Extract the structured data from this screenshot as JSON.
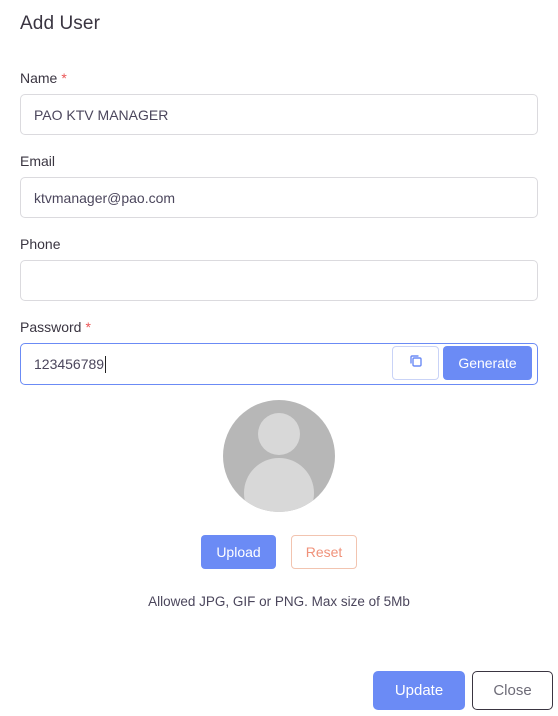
{
  "dialog": {
    "title": "Add User"
  },
  "form": {
    "name": {
      "label": "Name",
      "required_mark": "*",
      "value": "PAO KTV MANAGER"
    },
    "email": {
      "label": "Email",
      "value": "ktvmanager@pao.com"
    },
    "phone": {
      "label": "Phone",
      "value": ""
    },
    "password": {
      "label": "Password",
      "required_mark": "*",
      "value": "123456789",
      "copy_icon": "copy-icon",
      "generate_label": "Generate"
    }
  },
  "avatar": {
    "icon": "user-placeholder-avatar",
    "upload_label": "Upload",
    "reset_label": "Reset",
    "hint": "Allowed JPG, GIF or PNG. Max size of 5Mb"
  },
  "footer": {
    "update_label": "Update",
    "close_label": "Close"
  },
  "colors": {
    "primary": "#6b8bf5",
    "required": "#ea5455",
    "reset_text": "#f0927a"
  }
}
